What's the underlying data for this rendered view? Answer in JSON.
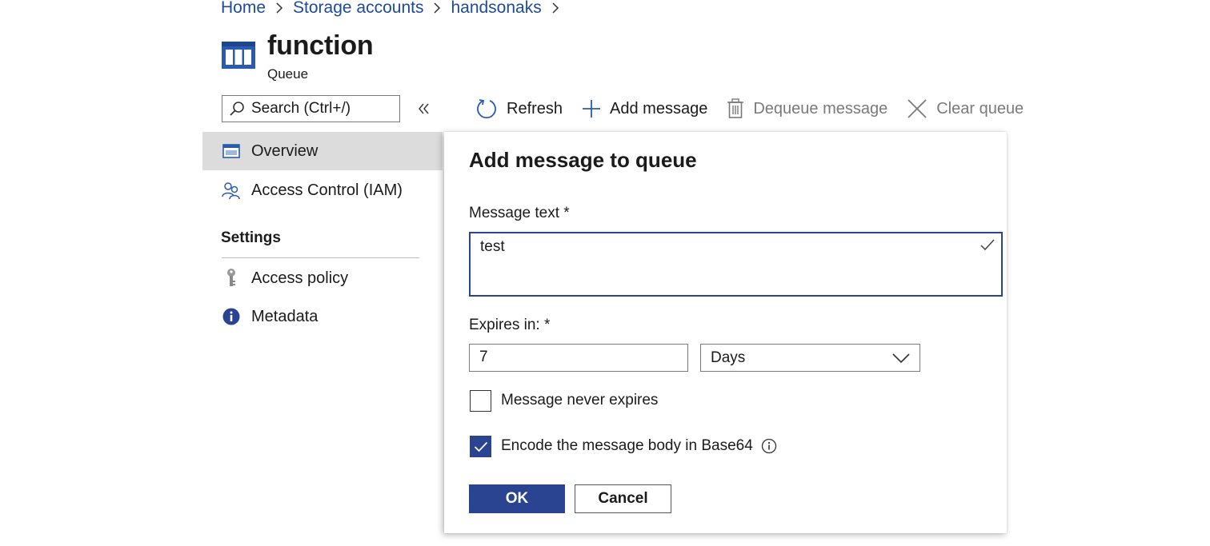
{
  "breadcrumb": {
    "items": [
      "Home",
      "Storage accounts",
      "handsonaks"
    ]
  },
  "header": {
    "title": "function",
    "subtitle": "Queue",
    "icon": "queue-icon"
  },
  "sidebar": {
    "search_placeholder": "Search (Ctrl+/)",
    "items": [
      {
        "label": "Overview",
        "icon": "overview-icon",
        "active": true
      },
      {
        "label": "Access Control (IAM)",
        "icon": "people-icon",
        "active": false
      }
    ],
    "settings_heading": "Settings",
    "settings_items": [
      {
        "label": "Access policy",
        "icon": "key-icon"
      },
      {
        "label": "Metadata",
        "icon": "info-icon"
      }
    ]
  },
  "toolbar": {
    "refresh_label": "Refresh",
    "add_message_label": "Add message",
    "dequeue_label": "Dequeue message",
    "clear_label": "Clear queue"
  },
  "panel": {
    "title": "Add message to queue",
    "message_text_label": "Message text *",
    "message_text_value": "test",
    "expires_label": "Expires in: *",
    "expires_value": "7",
    "expires_unit": "Days",
    "never_expires_label": "Message never expires",
    "never_expires_checked": false,
    "encode_label": "Encode the message body in Base64",
    "encode_checked": true,
    "ok_label": "OK",
    "cancel_label": "Cancel"
  },
  "colors": {
    "accent": "#2b4491",
    "link": "#1e4aa0",
    "active_nav_bg": "#dcdcdc",
    "disabled_text": "#7a7a7a"
  }
}
